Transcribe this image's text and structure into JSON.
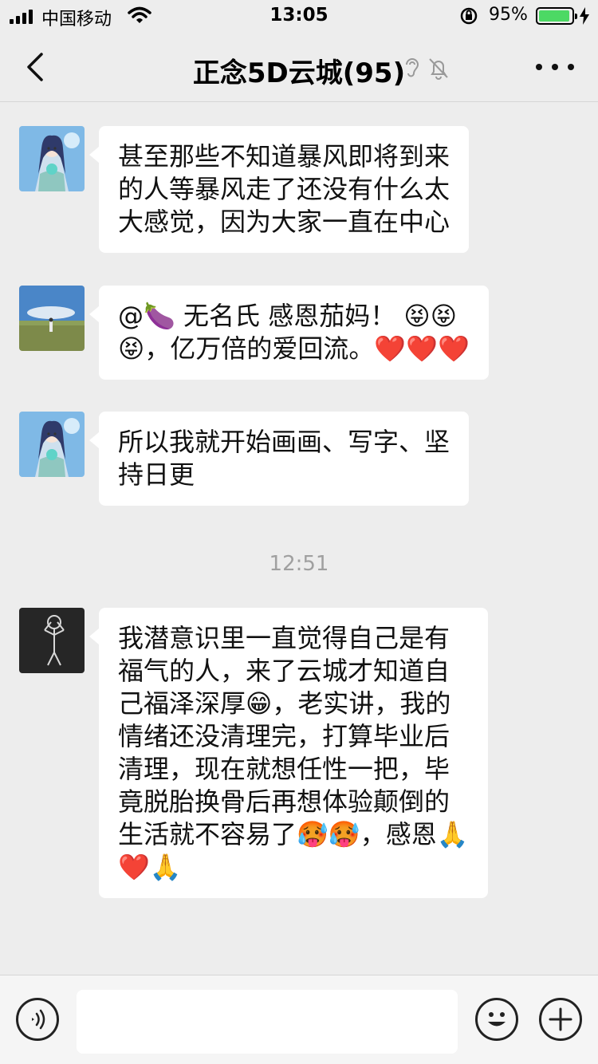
{
  "status_bar": {
    "carrier": "中国移动",
    "time": "13:05",
    "battery_percent": "95%",
    "battery_level": 0.95,
    "icons": [
      "signal-icon",
      "wifi-icon",
      "orientation-lock-icon",
      "battery-icon",
      "charging-icon"
    ]
  },
  "header": {
    "title": "正念5D云城(95)",
    "icons": [
      "back-arrow-icon",
      "earpiece-icon",
      "mute-bell-icon",
      "more-icon"
    ]
  },
  "messages": [
    {
      "avatar": "anime-girl-avatar",
      "lines": [
        "甚至那些不知道暴风即将到来",
        "的人等暴风走了还没有什么太",
        "大感觉，因为大家一直在中心"
      ]
    },
    {
      "avatar": "meadow-photo-avatar",
      "lines": [
        "@🍆 无名氏 感恩茄妈！ 😝😝",
        "😝，亿万倍的爱回流。❤️❤️❤️"
      ]
    },
    {
      "avatar": "anime-girl-avatar",
      "lines": [
        "所以我就开始画画、写字、坚",
        "持日更"
      ]
    },
    {
      "avatar": "chalk-figure-avatar",
      "lines": [
        "我潜意识里一直觉得自己是有",
        "福气的人，来了云城才知道自",
        "己福泽深厚😁，老实讲，我的",
        "情绪还没清理完，打算毕业后",
        "清理，现在就想任性一把，毕",
        "竟脱胎换骨后再想体验颠倒的",
        "生活就不容易了🥵🥵，感恩🙏",
        "❤️🙏"
      ]
    }
  ],
  "time_divider": "12:51",
  "input_bar": {
    "icons": [
      "voice-icon",
      "emoji-icon",
      "plus-icon"
    ]
  }
}
